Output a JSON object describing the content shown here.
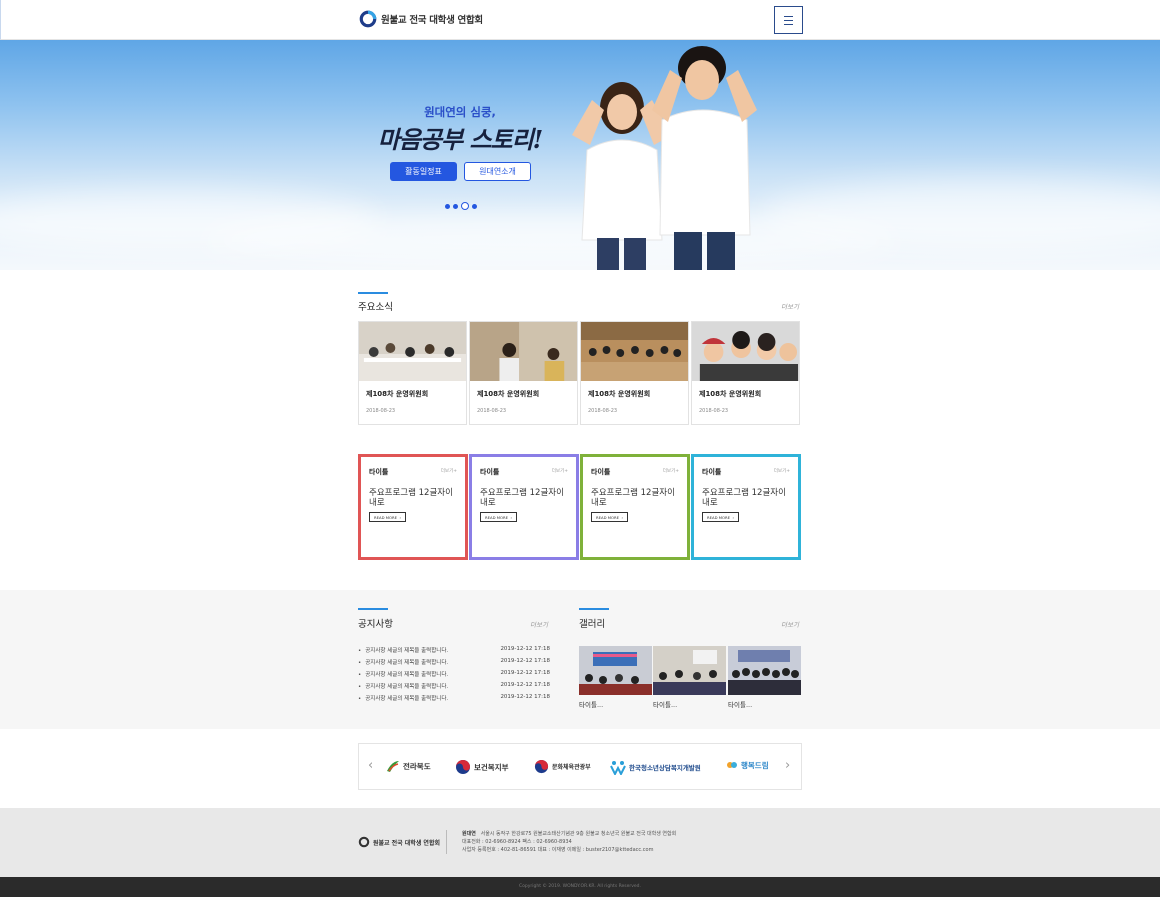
{
  "header": {
    "logo_text": "원불교 전국 대학생 연합회",
    "menu_icon": "hamburger-icon"
  },
  "hero": {
    "subtitle": "원대연의 심쿵,",
    "title": "마음공부 스토리!",
    "btn_schedule": "활동일정표",
    "btn_intro": "원대연소개",
    "slides_total": 4,
    "slide_active_index": 2
  },
  "news": {
    "title": "주요소식",
    "more": "더보기",
    "items": [
      {
        "title": "제108차 운영위원회",
        "date": "2018-08-23"
      },
      {
        "title": "제108차 운영위원회",
        "date": "2018-08-23"
      },
      {
        "title": "제108차 운영위원회",
        "date": "2018-08-23"
      },
      {
        "title": "제108차 운영위원회",
        "date": "2018-08-23"
      }
    ]
  },
  "programs": [
    {
      "title": "타이틀",
      "more": "더보기+",
      "desc": "주요프로그램 12글자이내로",
      "btn": "READ MORE",
      "color": "#e05555"
    },
    {
      "title": "타이틀",
      "more": "더보기+",
      "desc": "주요프로그램 12글자이내로",
      "btn": "READ MORE",
      "color": "#8a7ee6"
    },
    {
      "title": "타이틀",
      "more": "더보기+",
      "desc": "주요프로그램 12글자이내로",
      "btn": "READ MORE",
      "color": "#7fb13a"
    },
    {
      "title": "타이틀",
      "more": "더보기+",
      "desc": "주요프로그램 12글자이내로",
      "btn": "READ MORE",
      "color": "#2fb3d9"
    }
  ],
  "notice": {
    "title": "공지사항",
    "more": "더보기",
    "items": [
      {
        "text": "공지사항 세글의 제목을 출력합니다.",
        "date": "2019-12-12 17:18"
      },
      {
        "text": "공지사항 세글의 제목을 출력합니다.",
        "date": "2019-12-12 17:18"
      },
      {
        "text": "공지사항 세글의 제목을 출력합니다.",
        "date": "2019-12-12 17:18"
      },
      {
        "text": "공지사항 세글의 제목을 출력합니다.",
        "date": "2019-12-12 17:18"
      },
      {
        "text": "공지사항 세글의 제목을 출력합니다.",
        "date": "2019-12-12 17:18"
      }
    ]
  },
  "gallery": {
    "title": "갤러리",
    "more": "더보기",
    "items": [
      {
        "caption": "타이틀..."
      },
      {
        "caption": "타이틀..."
      },
      {
        "caption": "타이틀..."
      }
    ]
  },
  "partners": {
    "prev": "‹",
    "next": "›",
    "items": [
      "전라북도",
      "보건복지부",
      "문화체육관광부",
      "한국청소년상담복지개발원",
      "행복드림"
    ]
  },
  "footer": {
    "logo_text": "원불교 전국 대학생 연합회",
    "org": "원대연",
    "address": "서울시 동작구 한강로75 원불교소태산기념관 9층 원불교 청소년국 원불교 전국 대학생 연합회",
    "phone": "대표전화 : 02-6960-8924   팩스 : 02-6960-8934",
    "biz": "사업자 등록번호 : 402-81-86591   대표 : 이재영   이메일 : buster2107@kttedacc.com",
    "copyright": "Copyright © 2019. WONDY.OR.KR. All rights Reserved."
  }
}
